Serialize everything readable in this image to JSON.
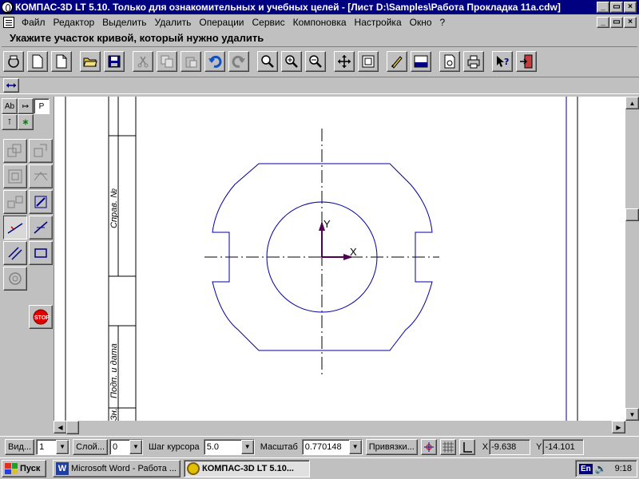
{
  "window": {
    "title": "КОМПАС-3D LT 5.10. Только для ознакомительных и учебных целей - [Лист D:\\Samples\\Работа Прокладка 11а.cdw]",
    "buttons": [
      "minimize",
      "restore",
      "close"
    ]
  },
  "menu": {
    "items": [
      "Файл",
      "Редактор",
      "Выделить",
      "Удалить",
      "Операции",
      "Сервис",
      "Компоновка",
      "Настройка",
      "Окно",
      "?"
    ]
  },
  "prompt": {
    "text": "Укажите участок кривой, который нужно удалить"
  },
  "toolbar": {
    "buttons": [
      "print-preview",
      "new-sheet",
      "new-fragment",
      "open",
      "save",
      "cut",
      "copy",
      "paste",
      "undo",
      "redo",
      "zoom",
      "zoom-in",
      "zoom-out",
      "pan",
      "zoom-fit",
      "refresh",
      "spec",
      "doc-manager",
      "print",
      "help",
      "exit"
    ]
  },
  "drawing": {
    "title_block": {
      "top": "Справ. №",
      "bottom": "Подп. и дата",
      "last": "Зн."
    },
    "axes": {
      "x": "X",
      "y": "Y"
    },
    "colors": {
      "geometry": "#0000a0",
      "axis": "#500050",
      "frame": "#000000"
    }
  },
  "status": {
    "view_label": "Вид...",
    "view_value": "1",
    "layer_label": "Слой...",
    "layer_value": "0",
    "step_label": "Шаг курсора",
    "step_value": "5.0",
    "scale_label": "Масштаб",
    "scale_value": "0.770148",
    "snap_label": "Привязки...",
    "x_label": "X",
    "x_value": "-9.638",
    "y_label": "Y",
    "y_value": "-14.101"
  },
  "taskbar": {
    "start": "Пуск",
    "tasks": [
      {
        "label": "Microsoft Word - Работа ...",
        "active": false
      },
      {
        "label": "КОМПАС-3D LT 5.10...",
        "active": true
      }
    ],
    "lang": "En",
    "clock": "9:18"
  }
}
